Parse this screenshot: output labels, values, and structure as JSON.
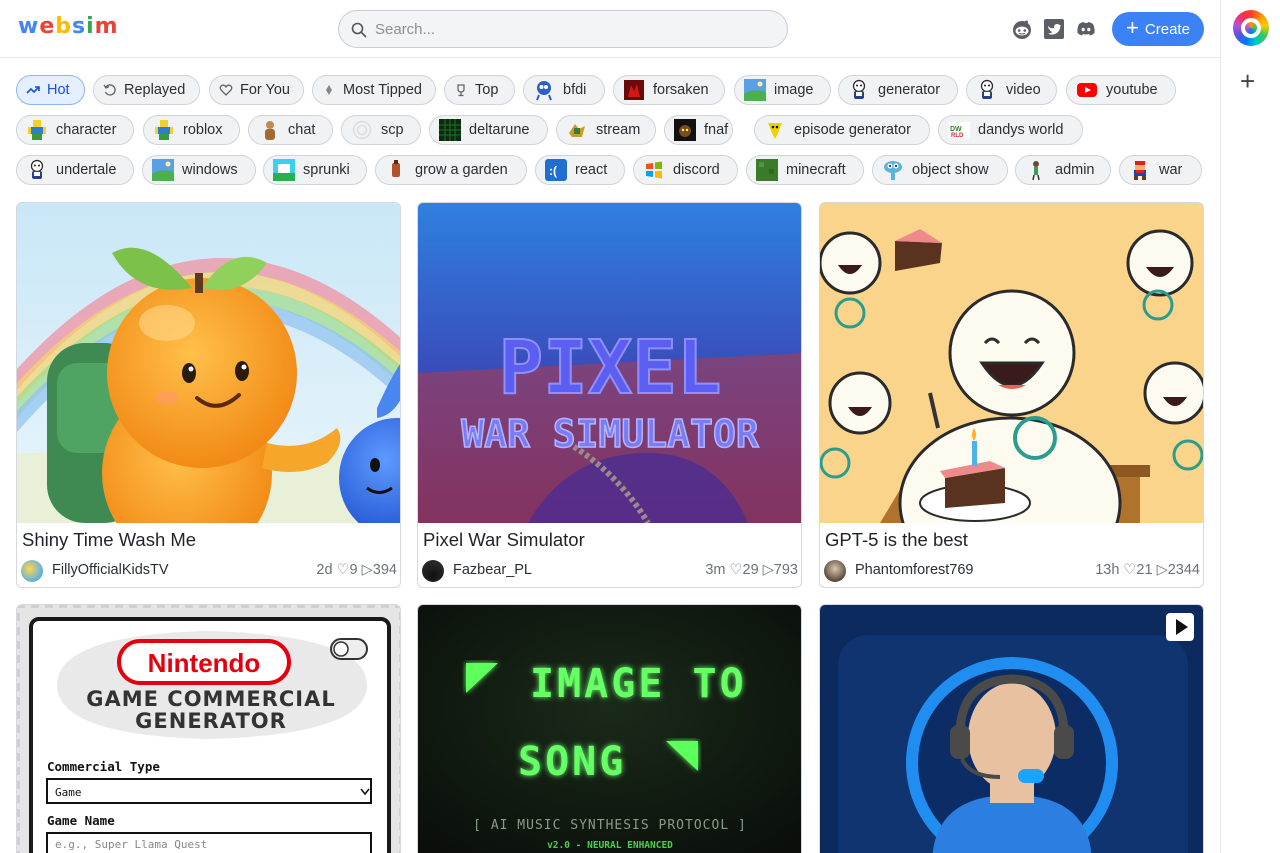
{
  "brand": {
    "logo_letters": [
      "w",
      "e",
      "b",
      "s",
      "i",
      "m"
    ],
    "logo_colors": [
      "#4285f4",
      "#ea4335",
      "#fbbc05",
      "#4285f4",
      "#34a853",
      "#ea4335"
    ]
  },
  "search": {
    "placeholder": "Search..."
  },
  "header_icons": [
    "reddit-icon",
    "twitter-icon",
    "discord-icon"
  ],
  "create_button": {
    "label": "Create",
    "color": "#3b82f6"
  },
  "tags": {
    "row1": [
      {
        "label": "Hot",
        "icon": "trending-icon",
        "active": true
      },
      {
        "label": "Replayed",
        "icon": "replay-icon"
      },
      {
        "label": "For You",
        "icon": "heart-icon"
      },
      {
        "label": "Most Tipped",
        "icon": "diamond-icon"
      },
      {
        "label": "Top",
        "icon": "trophy-icon"
      },
      {
        "label": "bfdi",
        "icon": "bfdi-icon"
      },
      {
        "label": "forsaken",
        "icon": "forsaken-icon"
      },
      {
        "label": "image",
        "icon": "landscape-icon"
      },
      {
        "label": "generator",
        "icon": "sans-icon"
      },
      {
        "label": "video",
        "icon": "sans-icon"
      },
      {
        "label": "youtube",
        "icon": "youtube-icon"
      }
    ],
    "row2": [
      {
        "label": "character",
        "icon": "roblox-noob-icon"
      },
      {
        "label": "roblox",
        "icon": "roblox-noob-icon"
      },
      {
        "label": "chat",
        "icon": "chat-figure-icon"
      },
      {
        "label": "scp",
        "icon": "scp-icon"
      },
      {
        "label": "deltarune",
        "icon": "deltarune-icon"
      },
      {
        "label": "stream",
        "icon": "stream-icon"
      },
      {
        "label": "fnaf",
        "icon": "fnaf-icon"
      },
      {
        "label": "episode generator",
        "icon": "episode-icon"
      },
      {
        "label": "dandys world",
        "icon": "dandys-icon"
      }
    ],
    "row3": [
      {
        "label": "undertale",
        "icon": "sans-icon"
      },
      {
        "label": "windows",
        "icon": "landscape-icon"
      },
      {
        "label": "sprunki",
        "icon": "sprunki-icon"
      },
      {
        "label": "grow a garden",
        "icon": "garden-icon"
      },
      {
        "label": "react",
        "icon": "sad-face-icon"
      },
      {
        "label": "discord",
        "icon": "windows-logo-icon"
      },
      {
        "label": "minecraft",
        "icon": "minecraft-icon"
      },
      {
        "label": "object show",
        "icon": "object-show-icon"
      },
      {
        "label": "admin",
        "icon": "admin-icon"
      },
      {
        "label": "war",
        "icon": "mario-icon"
      }
    ]
  },
  "cards": [
    {
      "title": "Shiny Time Wash Me",
      "author": "FillyOfficialKidsTV",
      "stats": "2d ♡9 ▷394",
      "thumb": "orange-character"
    },
    {
      "title": "Pixel War Simulator",
      "author": "Fazbear_PL",
      "stats": "3m ♡29 ▷793",
      "thumb": "pixel-war",
      "thumb_text": {
        "line1": "PIXEL",
        "line2": "WAR SIMULATOR"
      }
    },
    {
      "title": "GPT-5 is the best",
      "author": "Phantomforest769",
      "stats": "13h ♡21 ▷2344",
      "thumb": "gpt5-party"
    },
    {
      "title": "",
      "author": "",
      "stats": "",
      "thumb": "nintendo-generator",
      "thumb_text": {
        "logo": "Nintendo",
        "heading1": "GAME COMMERCIAL",
        "heading2": "GENERATOR",
        "field1_label": "Commercial Type",
        "field1_value": "Game",
        "field2_label": "Game Name",
        "field2_placeholder": "e.g., Super Llama Quest"
      }
    },
    {
      "title": "",
      "author": "",
      "stats": "",
      "thumb": "image-to-song",
      "thumb_text": {
        "line1": "IMAGE TO",
        "line2": "SONG",
        "sub": "[ AI MUSIC SYNTHESIS PROTOCOL ]",
        "version": "v2.0 - NEURAL ENHANCED"
      }
    },
    {
      "title": "",
      "author": "",
      "stats": "",
      "thumb": "support-agent"
    }
  ]
}
